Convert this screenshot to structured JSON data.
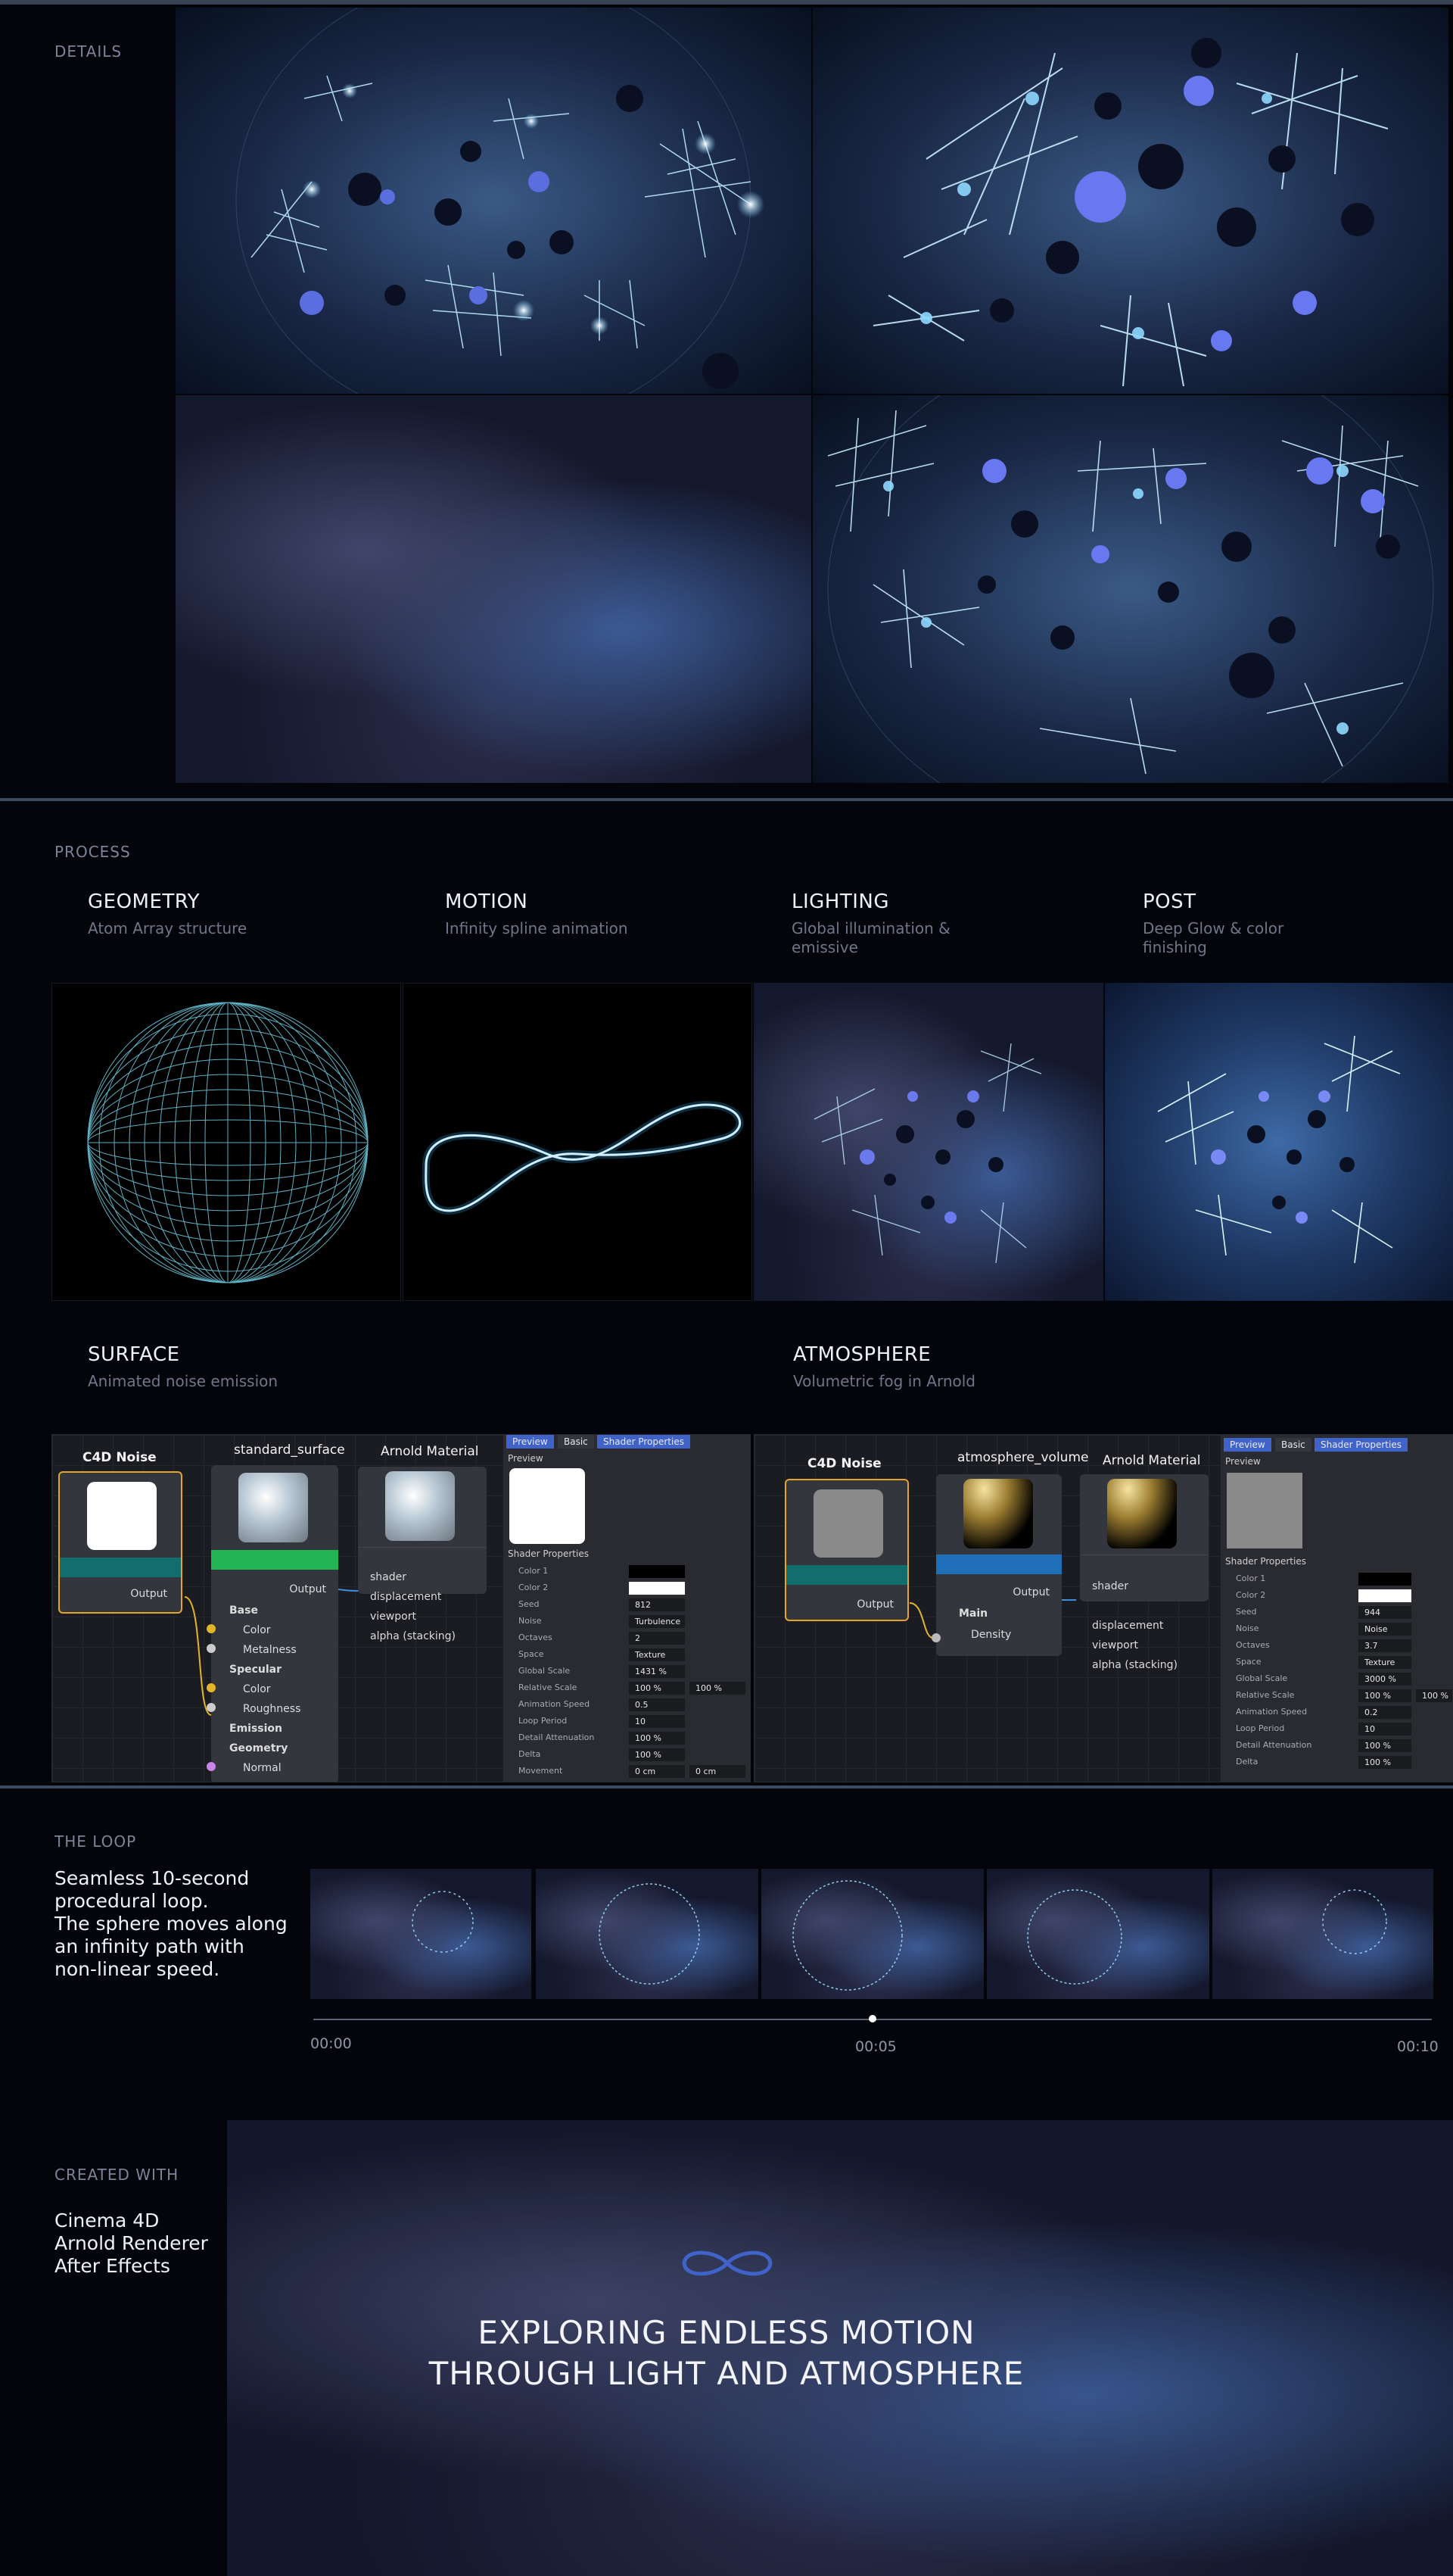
{
  "details": {
    "label": "DETAILS"
  },
  "process": {
    "label": "PROCESS",
    "items": [
      {
        "title": "GEOMETRY",
        "subtitle": "Atom Array structure"
      },
      {
        "title": "MOTION",
        "subtitle": "Infinity spline animation"
      },
      {
        "title": "LIGHTING",
        "subtitle": "Global illumination & emissive"
      },
      {
        "title": "POST",
        "subtitle": "Deep Glow & color finishing"
      }
    ],
    "surface": {
      "title": "SURFACE",
      "subtitle": "Animated noise emission"
    },
    "atmosphere": {
      "title": "ATMOSPHERE",
      "subtitle": "Volumetric fog in Arnold"
    }
  },
  "surface_graph": {
    "noise_node": "C4D Noise",
    "standard_node": "standard_surface",
    "arnold_node": "Arnold Material",
    "output": "Output",
    "inputs": [
      "Base",
      "Color",
      "Metalness",
      "Specular",
      "Color",
      "Roughness",
      "Emission",
      "Geometry",
      "Normal"
    ],
    "material_ports": [
      "shader",
      "displacement",
      "viewport",
      "alpha (stacking)"
    ],
    "tabs": [
      "Preview",
      "Basic",
      "Shader Properties"
    ],
    "preview_label": "Preview",
    "props_header": "Shader Properties",
    "props": [
      {
        "name": "Color 1",
        "value": ""
      },
      {
        "name": "Color 2",
        "value": ""
      },
      {
        "name": "Seed",
        "value": "812"
      },
      {
        "name": "Noise",
        "value": "Turbulence"
      },
      {
        "name": "Octaves",
        "value": "2"
      },
      {
        "name": "Space",
        "value": "Texture"
      },
      {
        "name": "Global Scale",
        "value": "1431 %"
      },
      {
        "name": "Relative Scale",
        "value": "100 %",
        "value2": "100 %"
      },
      {
        "name": "Animation Speed",
        "value": "0.5"
      },
      {
        "name": "Loop Period",
        "value": "10"
      },
      {
        "name": "Detail Attenuation",
        "value": "100 %"
      },
      {
        "name": "Delta",
        "value": "100 %"
      },
      {
        "name": "Movement",
        "value": "0 cm",
        "value2": "0 cm"
      }
    ]
  },
  "atmo_graph": {
    "noise_node": "C4D Noise",
    "volume_node": "atmosphere_volume",
    "arnold_node": "Arnold Material",
    "output": "Output",
    "inputs": [
      "Main",
      "Density"
    ],
    "material_ports": [
      "shader",
      "displacement",
      "viewport",
      "alpha (stacking)"
    ],
    "tabs": [
      "Preview",
      "Basic",
      "Shader Properties"
    ],
    "preview_label": "Preview",
    "props_header": "Shader Properties",
    "props": [
      {
        "name": "Color 1",
        "value": ""
      },
      {
        "name": "Color 2",
        "value": ""
      },
      {
        "name": "Seed",
        "value": "944"
      },
      {
        "name": "Noise",
        "value": "Noise"
      },
      {
        "name": "Octaves",
        "value": "3.7"
      },
      {
        "name": "Space",
        "value": "Texture"
      },
      {
        "name": "Global Scale",
        "value": "3000 %"
      },
      {
        "name": "Relative Scale",
        "value": "100 %",
        "value2": "100 %"
      },
      {
        "name": "Animation Speed",
        "value": "0.2"
      },
      {
        "name": "Loop Period",
        "value": "10"
      },
      {
        "name": "Detail Attenuation",
        "value": "100 %"
      },
      {
        "name": "Delta",
        "value": "100 %"
      }
    ]
  },
  "loop": {
    "label": "THE LOOP",
    "description": [
      "Seamless 10-second",
      "procedural loop.",
      "The sphere moves along",
      "an infinity path with",
      "non-linear speed."
    ],
    "times": [
      "00:00",
      "00:05",
      "00:10"
    ],
    "playhead": 0.5
  },
  "created": {
    "label": "CREATED WITH",
    "tools": [
      "Cinema 4D",
      "Arnold Renderer",
      "After Effects"
    ],
    "tagline": [
      "EXPLORING ENDLESS MOTION",
      "THROUGH LIGHT AND ATMOSPHERE"
    ]
  },
  "colors": {
    "accent": "#3f63c8",
    "background": "#04050b",
    "node_teal": "#126d6d",
    "node_green": "#22b455",
    "node_blue": "#1e6fb8",
    "port_yellow": "#e3b52b"
  }
}
